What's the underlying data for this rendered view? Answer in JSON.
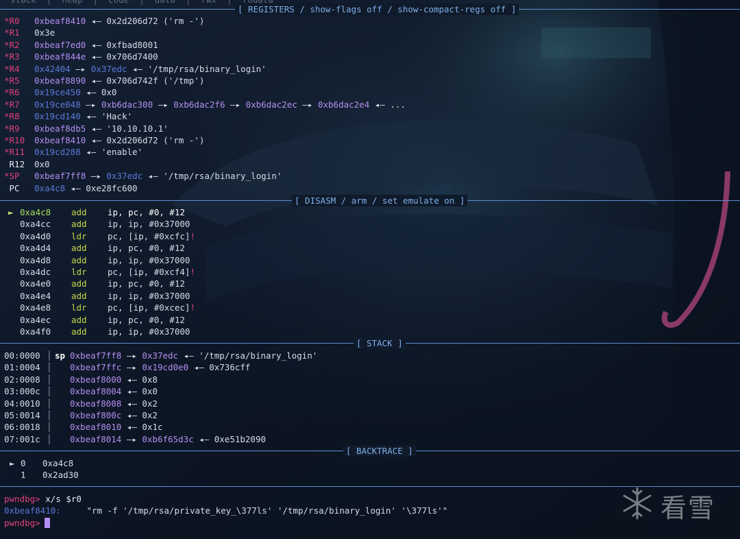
{
  "top_line": "  stack  |  heap  |  code  |  data  |  rwx  |  rodata",
  "sections": {
    "registers": "[ REGISTERS / show-flags off / show-compact-regs off ]",
    "disasm": "[ DISASM / arm / set emulate on ]",
    "stack": "[ STACK ]",
    "backtrace": "[ BACKTRACE ]"
  },
  "registers": [
    {
      "name": "R0",
      "star": "*",
      "parts": [
        {
          "t": "0xbeaf8410",
          "c": "stack"
        },
        {
          "t": " ◂— ",
          "c": "arrow"
        },
        {
          "t": "0x2d206d72 ('rm -')",
          "c": "val"
        }
      ]
    },
    {
      "name": "R1",
      "star": "*",
      "parts": [
        {
          "t": "0x3e",
          "c": "val"
        }
      ]
    },
    {
      "name": "R2",
      "star": "*",
      "parts": [
        {
          "t": "0xbeaf7ed0",
          "c": "stack"
        },
        {
          "t": " ◂— ",
          "c": "arrow"
        },
        {
          "t": "0xfbad8001",
          "c": "val"
        }
      ]
    },
    {
      "name": "R3",
      "star": "*",
      "parts": [
        {
          "t": "0xbeaf844e",
          "c": "stack"
        },
        {
          "t": " ◂— ",
          "c": "arrow"
        },
        {
          "t": "0x706d7400",
          "c": "val"
        }
      ]
    },
    {
      "name": "R4",
      "star": "*",
      "parts": [
        {
          "t": "0x42404",
          "c": "heap"
        },
        {
          "t": " —▸ ",
          "c": "arrow"
        },
        {
          "t": "0x37edc",
          "c": "heap"
        },
        {
          "t": " ◂— ",
          "c": "arrow"
        },
        {
          "t": "'/tmp/rsa/binary_login'",
          "c": "val"
        }
      ]
    },
    {
      "name": "R5",
      "star": "*",
      "parts": [
        {
          "t": "0xbeaf8890",
          "c": "stack"
        },
        {
          "t": " ◂— ",
          "c": "arrow"
        },
        {
          "t": "0x706d742f ('/tmp')",
          "c": "val"
        }
      ]
    },
    {
      "name": "R6",
      "star": "*",
      "parts": [
        {
          "t": "0x19ce450",
          "c": "heap"
        },
        {
          "t": " ◂— ",
          "c": "arrow"
        },
        {
          "t": "0x0",
          "c": "val"
        }
      ]
    },
    {
      "name": "R7",
      "star": "*",
      "parts": [
        {
          "t": "0x19ce048",
          "c": "heap"
        },
        {
          "t": " —▸ ",
          "c": "arrow"
        },
        {
          "t": "0xb6dac300",
          "c": "stack"
        },
        {
          "t": " —▸ ",
          "c": "arrow"
        },
        {
          "t": "0xb6dac2f6",
          "c": "stack"
        },
        {
          "t": " —▸ ",
          "c": "arrow"
        },
        {
          "t": "0xb6dac2ec",
          "c": "stack"
        },
        {
          "t": " —▸ ",
          "c": "arrow"
        },
        {
          "t": "0xb6dac2e4",
          "c": "stack"
        },
        {
          "t": " ◂— ...",
          "c": "arrow"
        }
      ]
    },
    {
      "name": "R8",
      "star": "*",
      "parts": [
        {
          "t": "0x19cd140",
          "c": "heap"
        },
        {
          "t": " ◂— ",
          "c": "arrow"
        },
        {
          "t": "'Hack'",
          "c": "val"
        }
      ]
    },
    {
      "name": "R9",
      "star": "*",
      "parts": [
        {
          "t": "0xbeaf8db5",
          "c": "stack"
        },
        {
          "t": " ◂— ",
          "c": "arrow"
        },
        {
          "t": "'10.10.10.1'",
          "c": "val"
        }
      ]
    },
    {
      "name": "R10",
      "star": "*",
      "parts": [
        {
          "t": "0xbeaf8410",
          "c": "stack"
        },
        {
          "t": " ◂— ",
          "c": "arrow"
        },
        {
          "t": "0x2d206d72 ('rm -')",
          "c": "val"
        }
      ]
    },
    {
      "name": "R11",
      "star": "*",
      "parts": [
        {
          "t": "0x19cd288",
          "c": "heap"
        },
        {
          "t": " ◂— ",
          "c": "arrow"
        },
        {
          "t": "'enable'",
          "c": "val"
        }
      ]
    },
    {
      "name": "R12",
      "star": "",
      "parts": [
        {
          "t": "0x0",
          "c": "val"
        }
      ]
    },
    {
      "name": "SP",
      "star": "*",
      "parts": [
        {
          "t": "0xbeaf7ff8",
          "c": "stack"
        },
        {
          "t": " —▸ ",
          "c": "arrow"
        },
        {
          "t": "0x37edc",
          "c": "heap"
        },
        {
          "t": " ◂— ",
          "c": "arrow"
        },
        {
          "t": "'/tmp/rsa/binary_login'",
          "c": "val"
        }
      ]
    },
    {
      "name": "PC",
      "star": "",
      "parts": [
        {
          "t": "0xa4c8",
          "c": "heap"
        },
        {
          "t": " ◂— ",
          "c": "arrow"
        },
        {
          "t": "0xe28fc600",
          "c": "val"
        }
      ]
    }
  ],
  "disasm": [
    {
      "marker": "►",
      "addr": "0xa4c8",
      "mn": "add",
      "op": "ip, pc, #0, #12",
      "flag": "",
      "cur": true
    },
    {
      "marker": "",
      "addr": "0xa4cc",
      "mn": "add",
      "op": "ip, ip, #0x37000",
      "flag": ""
    },
    {
      "marker": "",
      "addr": "0xa4d0",
      "mn": "ldr",
      "op": "pc, [ip, #0xcfc]",
      "flag": "!"
    },
    {
      "marker": "",
      "addr": "0xa4d4",
      "mn": "add",
      "op": "ip, pc, #0, #12",
      "flag": ""
    },
    {
      "marker": "",
      "addr": "0xa4d8",
      "mn": "add",
      "op": "ip, ip, #0x37000",
      "flag": ""
    },
    {
      "marker": "",
      "addr": "0xa4dc",
      "mn": "ldr",
      "op": "pc, [ip, #0xcf4]",
      "flag": "!"
    },
    {
      "marker": "",
      "addr": "0xa4e0",
      "mn": "add",
      "op": "ip, pc, #0, #12",
      "flag": ""
    },
    {
      "marker": "",
      "addr": "0xa4e4",
      "mn": "add",
      "op": "ip, ip, #0x37000",
      "flag": ""
    },
    {
      "marker": "",
      "addr": "0xa4e8",
      "mn": "ldr",
      "op": "pc, [ip, #0xcec]",
      "flag": "!"
    },
    {
      "marker": "",
      "addr": "0xa4ec",
      "mn": "add",
      "op": "ip, pc, #0, #12",
      "flag": ""
    },
    {
      "marker": "",
      "addr": "0xa4f0",
      "mn": "add",
      "op": "ip, ip, #0x37000",
      "flag": ""
    }
  ],
  "stack": [
    {
      "off": "00:0000",
      "sp": "sp",
      "parts": [
        {
          "t": "0xbeaf7ff8",
          "c": "stack"
        },
        {
          "t": " —▸ ",
          "c": "arrow"
        },
        {
          "t": "0x37edc",
          "c": "stack"
        },
        {
          "t": " ◂— ",
          "c": "arrow"
        },
        {
          "t": "'/tmp/rsa/binary_login'",
          "c": "val"
        }
      ]
    },
    {
      "off": "01:0004",
      "sp": "",
      "parts": [
        {
          "t": "0xbeaf7ffc",
          "c": "stack"
        },
        {
          "t": " —▸ ",
          "c": "arrow"
        },
        {
          "t": "0x19cd0e0",
          "c": "stack"
        },
        {
          "t": " ◂— ",
          "c": "arrow"
        },
        {
          "t": "0x736cff",
          "c": "val"
        }
      ]
    },
    {
      "off": "02:0008",
      "sp": "",
      "parts": [
        {
          "t": "0xbeaf8000",
          "c": "stack"
        },
        {
          "t": " ◂— ",
          "c": "arrow"
        },
        {
          "t": "0x8",
          "c": "val"
        }
      ]
    },
    {
      "off": "03:000c",
      "sp": "",
      "parts": [
        {
          "t": "0xbeaf8004",
          "c": "stack"
        },
        {
          "t": " ◂— ",
          "c": "arrow"
        },
        {
          "t": "0x0",
          "c": "val"
        }
      ]
    },
    {
      "off": "04:0010",
      "sp": "",
      "parts": [
        {
          "t": "0xbeaf8008",
          "c": "stack"
        },
        {
          "t": " ◂— ",
          "c": "arrow"
        },
        {
          "t": "0x2",
          "c": "val"
        }
      ]
    },
    {
      "off": "05:0014",
      "sp": "",
      "parts": [
        {
          "t": "0xbeaf800c",
          "c": "stack"
        },
        {
          "t": " ◂— ",
          "c": "arrow"
        },
        {
          "t": "0x2",
          "c": "val"
        }
      ]
    },
    {
      "off": "06:0018",
      "sp": "",
      "parts": [
        {
          "t": "0xbeaf8010",
          "c": "stack"
        },
        {
          "t": " ◂— ",
          "c": "arrow"
        },
        {
          "t": "0x1c",
          "c": "val"
        }
      ]
    },
    {
      "off": "07:001c",
      "sp": "",
      "parts": [
        {
          "t": "0xbeaf8014",
          "c": "stack"
        },
        {
          "t": " —▸ ",
          "c": "arrow"
        },
        {
          "t": "0xb6f65d3c",
          "c": "stack"
        },
        {
          "t": " ◂— ",
          "c": "arrow"
        },
        {
          "t": "0xe51b2090",
          "c": "val"
        }
      ]
    }
  ],
  "backtrace": [
    {
      "marker": "►",
      "idx": "0",
      "addr": "0xa4c8"
    },
    {
      "marker": "",
      "idx": "1",
      "addr": "0x2ad30"
    }
  ],
  "console": {
    "prompt": "pwndbg>",
    "command": "x/s $r0",
    "out_addr": "0xbeaf8410:",
    "out_text": "\"rm -f '/tmp/rsa/private_key_\\377ls' '/tmp/rsa/binary_login' '\\377ls'\"",
    "prompt2": "pwndbg>"
  },
  "watermark": "看雪",
  "colors": {
    "star": "#e0407a",
    "stack": "#b58ef0",
    "heap": "#5e79d8",
    "mnemonic": "#c5d84a",
    "accent": "#5d8fd0"
  }
}
